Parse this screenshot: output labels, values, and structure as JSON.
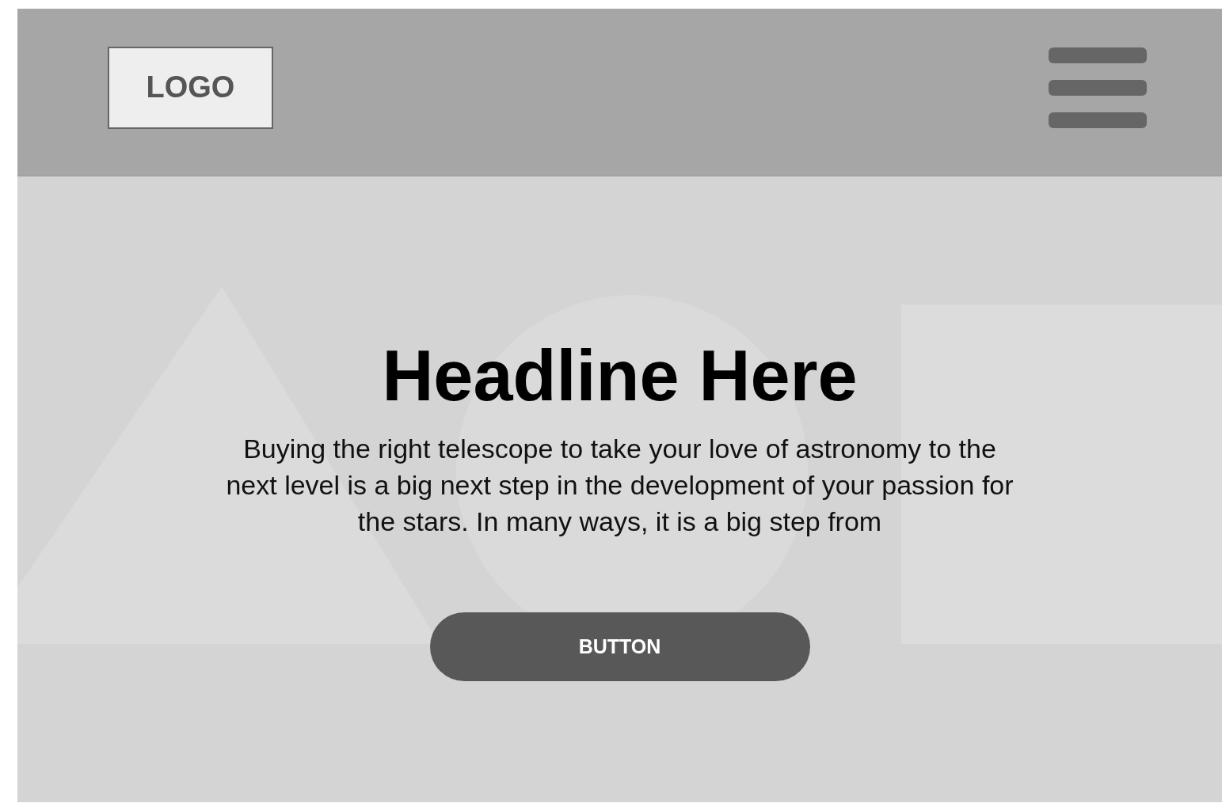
{
  "header": {
    "logo": "LOGO",
    "menu_button": {
      "kind": "hamburger"
    }
  },
  "hero": {
    "headline": "Headline Here",
    "body": "Buying the right telescope to take your love of astronomy to the next level is a big next step in the development of your passion for the stars. In many ways, it is a big step from",
    "button": "BUTTON"
  }
}
